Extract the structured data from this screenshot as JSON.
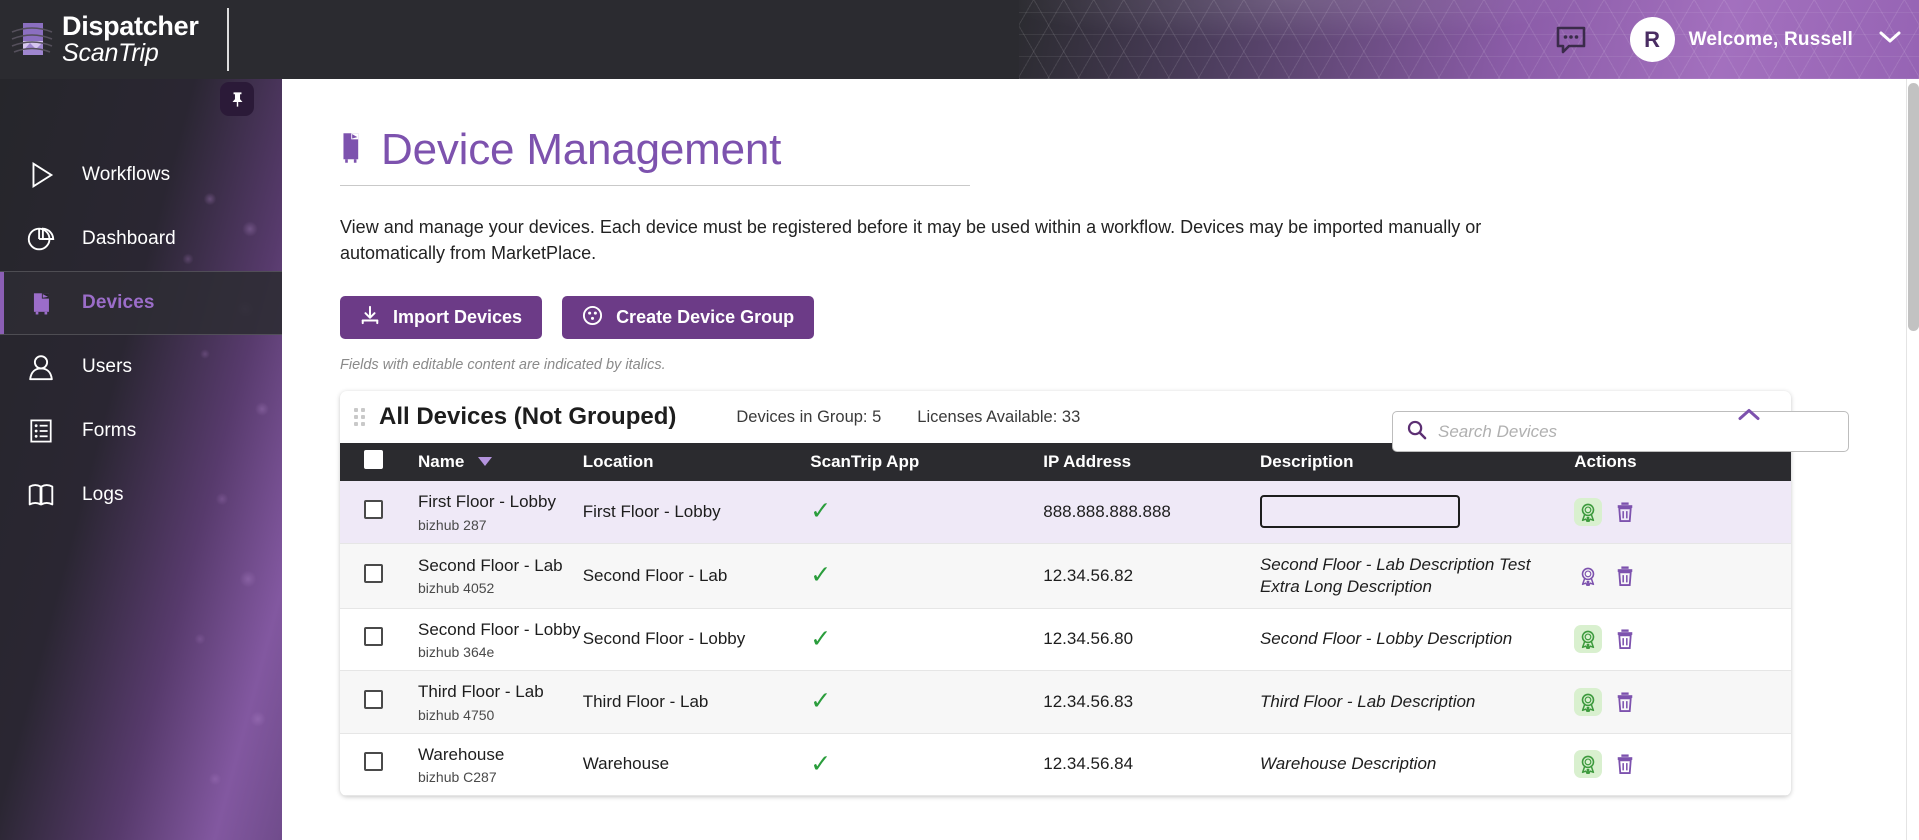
{
  "app": {
    "logo_line1": "Dispatcher",
    "logo_line2": "ScanTrip"
  },
  "header": {
    "chat_icon": "chat-bubble-icon",
    "avatar_initial": "R",
    "welcome": "Welcome, Russell",
    "caret_icon": "chevron-down-icon"
  },
  "sidebar": {
    "pin_icon": "pin-icon",
    "items": [
      {
        "label": "Workflows",
        "icon": "play-triangle-icon",
        "active": false
      },
      {
        "label": "Dashboard",
        "icon": "pie-chart-icon",
        "active": false
      },
      {
        "label": "Devices",
        "icon": "printer-icon",
        "active": true
      },
      {
        "label": "Users",
        "icon": "person-icon",
        "active": false
      },
      {
        "label": "Forms",
        "icon": "list-form-icon",
        "active": false
      },
      {
        "label": "Logs",
        "icon": "book-icon",
        "active": false
      }
    ]
  },
  "page": {
    "title": "Device Management",
    "title_icon": "printer-icon",
    "description": "View and manage your devices. Each device must be registered before it may be used within a workflow. Devices may be imported manually or automatically from MarketPlace.",
    "italic_note": "Fields with editable content are indicated by italics."
  },
  "toolbar": {
    "import_label": "Import Devices",
    "import_icon": "download-icon",
    "create_group_label": "Create Device Group",
    "create_group_icon": "device-group-icon"
  },
  "search": {
    "placeholder": "Search Devices",
    "value": "",
    "icon": "search-icon"
  },
  "group": {
    "drag_handle_icon": "drag-grip-icon",
    "name": "All Devices (Not Grouped)",
    "devices_in_group": "Devices in Group: 5",
    "licenses_available": "Licenses Available: 33",
    "collapse_icon": "chevron-up-icon"
  },
  "table": {
    "columns": [
      {
        "key": "check",
        "label": ""
      },
      {
        "key": "name",
        "label": "Name",
        "sort_icon": "sort-descending-triangle-icon"
      },
      {
        "key": "loc",
        "label": "Location"
      },
      {
        "key": "app",
        "label": "ScanTrip App"
      },
      {
        "key": "ip",
        "label": "IP Address"
      },
      {
        "key": "desc",
        "label": "Description"
      },
      {
        "key": "act",
        "label": "Actions"
      }
    ],
    "rows": [
      {
        "name": "First Floor - Lobby",
        "model": "bizhub 287",
        "location": "First Floor - Lobby",
        "scantrip_app": true,
        "ip": "888.888.888.888",
        "description": "",
        "description_editing": true,
        "selected": true,
        "license_active": true
      },
      {
        "name": "Second Floor - Lab",
        "model": "bizhub 4052",
        "location": "Second Floor - Lab",
        "scantrip_app": true,
        "ip": "12.34.56.82",
        "description": "Second Floor - Lab Description Test Extra Long Description",
        "description_editing": false,
        "selected": false,
        "license_active": false
      },
      {
        "name": "Second Floor - Lobby",
        "model": "bizhub 364e",
        "location": "Second Floor - Lobby",
        "scantrip_app": true,
        "ip": "12.34.56.80",
        "description": "Second Floor - Lobby Description",
        "description_editing": false,
        "selected": false,
        "license_active": true
      },
      {
        "name": "Third Floor - Lab",
        "model": "bizhub 4750",
        "location": "Third Floor - Lab",
        "scantrip_app": true,
        "ip": "12.34.56.83",
        "description": "Third Floor - Lab Description",
        "description_editing": false,
        "selected": false,
        "license_active": true
      },
      {
        "name": "Warehouse",
        "model": "bizhub C287",
        "location": "Warehouse",
        "scantrip_app": true,
        "ip": "12.34.56.84",
        "description": "Warehouse Description",
        "description_editing": false,
        "selected": false,
        "license_active": true
      }
    ],
    "checkmark_glyph": "✓"
  },
  "colors": {
    "brand_purple": "#7d52ae",
    "button_purple": "#6c3b87",
    "header_dark": "#2b2b2f",
    "check_green": "#2a9d3c",
    "row_selected": "#efe9f7"
  }
}
